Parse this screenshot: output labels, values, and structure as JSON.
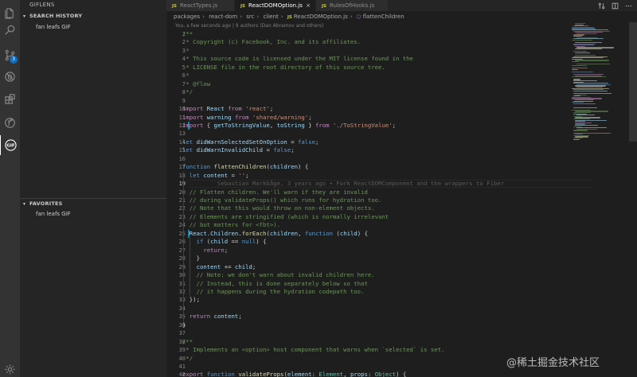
{
  "activity_bar": {
    "items": [
      {
        "name": "explorer-icon"
      },
      {
        "name": "search-icon"
      },
      {
        "name": "source-control-icon",
        "badge": "3"
      },
      {
        "name": "debug-icon"
      },
      {
        "name": "extensions-icon"
      },
      {
        "name": "gitlens-icon"
      },
      {
        "name": "gif-icon",
        "label": "GIF"
      }
    ],
    "settings": "gear-icon"
  },
  "sidebar": {
    "title": "GIFLENS",
    "search_history": {
      "header": "SEARCH HISTORY",
      "items": [
        "fan leafs GIF"
      ]
    },
    "favorites": {
      "header": "FAVORITES",
      "items": [
        "fan leafs GIF"
      ]
    }
  },
  "tabs": [
    {
      "icon": "JS",
      "label": "ReactTypes.js",
      "active": false
    },
    {
      "icon": "JS",
      "label": "ReactDOMOption.js",
      "active": true,
      "close": "×"
    },
    {
      "icon": "JS",
      "label": "RulesOfHooks.js",
      "active": false
    }
  ],
  "breadcrumb": {
    "parts": [
      "packages",
      "react-dom",
      "src",
      "client"
    ],
    "file_icon": "JS",
    "file": "ReactDOMOption.js",
    "symbol": "flattenChildren"
  },
  "editor": {
    "blame_header": "You, a few seconds ago | 9 authors (Dan Abramov and others)",
    "current_line": 19,
    "inline_blame": "Sebastian Markbåge, 3 years ago • Fork ReactDOMComponent and the wrappers to Fiber",
    "lines": [
      {
        "n": "1",
        "text": "/**"
      },
      {
        "n": "2",
        "text": " * Copyright (c) Facebook, Inc. and its affiliates."
      },
      {
        "n": "3",
        "text": " *"
      },
      {
        "n": "4",
        "text": " * This source code is licensed under the MIT license found in the"
      },
      {
        "n": "5",
        "text": " * LICENSE file in the root directory of this source tree."
      },
      {
        "n": "6",
        "text": " *"
      },
      {
        "n": "7",
        "text": " * @flow"
      },
      {
        "n": "8",
        "text": " */"
      },
      {
        "n": "9",
        "text": ""
      },
      {
        "n": "10",
        "text": "import React from 'react';"
      },
      {
        "n": "11",
        "text": "import warning from 'shared/warning';"
      },
      {
        "n": "12",
        "text": "import { getToStringValue, toString } from './ToStringValue';"
      },
      {
        "n": "13",
        "text": ""
      },
      {
        "n": "14",
        "text": "let didWarnSelectedSetOnOption = false;"
      },
      {
        "n": "15",
        "text": "let didWarnInvalidChild = false;"
      },
      {
        "n": "16",
        "text": ""
      },
      {
        "n": "17",
        "text": "function flattenChildren(children) {"
      },
      {
        "n": "18",
        "text": "  let content = '';"
      },
      {
        "n": "19",
        "text": ""
      },
      {
        "n": "20",
        "text": "  // Flatten children. We'll warn if they are invalid"
      },
      {
        "n": "21",
        "text": "  // during validateProps() which runs for hydration too."
      },
      {
        "n": "22",
        "text": "  // Note that this would throw on non-element objects."
      },
      {
        "n": "23",
        "text": "  // Elements are stringified (which is normally irrelevant"
      },
      {
        "n": "24",
        "text": "  // but matters for <fbt>)."
      },
      {
        "n": "25",
        "text": "  React.Children.forEach(children, function (child) {"
      },
      {
        "n": "26",
        "text": "    if (child == null) {"
      },
      {
        "n": "27",
        "text": "      return;"
      },
      {
        "n": "28",
        "text": "    }"
      },
      {
        "n": "29",
        "text": "    content += child;"
      },
      {
        "n": "30",
        "text": "    // Note: we don't warn about invalid children here."
      },
      {
        "n": "31",
        "text": "    // Instead, this is done separately below so that"
      },
      {
        "n": "32",
        "text": "    // it happens during the hydration codepath too."
      },
      {
        "n": "33",
        "text": "  });"
      },
      {
        "n": "34",
        "text": ""
      },
      {
        "n": "35",
        "text": "  return content;"
      },
      {
        "n": "36",
        "text": "}"
      },
      {
        "n": "37",
        "text": ""
      },
      {
        "n": "38",
        "text": "/**"
      },
      {
        "n": "39",
        "text": " * Implements an <option> host component that warns when `selected` is set."
      },
      {
        "n": "40",
        "text": " */"
      },
      {
        "n": "41",
        "text": ""
      },
      {
        "n": "42",
        "text": "export function validateProps(element: Element, props: Object) {"
      }
    ]
  },
  "watermark": "@稀土掘金技术社区",
  "colors": {
    "activity_bar": "#333333",
    "sidebar": "#252526",
    "editor": "#1e1e1e",
    "badge": "#0e70c0",
    "js_icon": "#cbcb41"
  }
}
